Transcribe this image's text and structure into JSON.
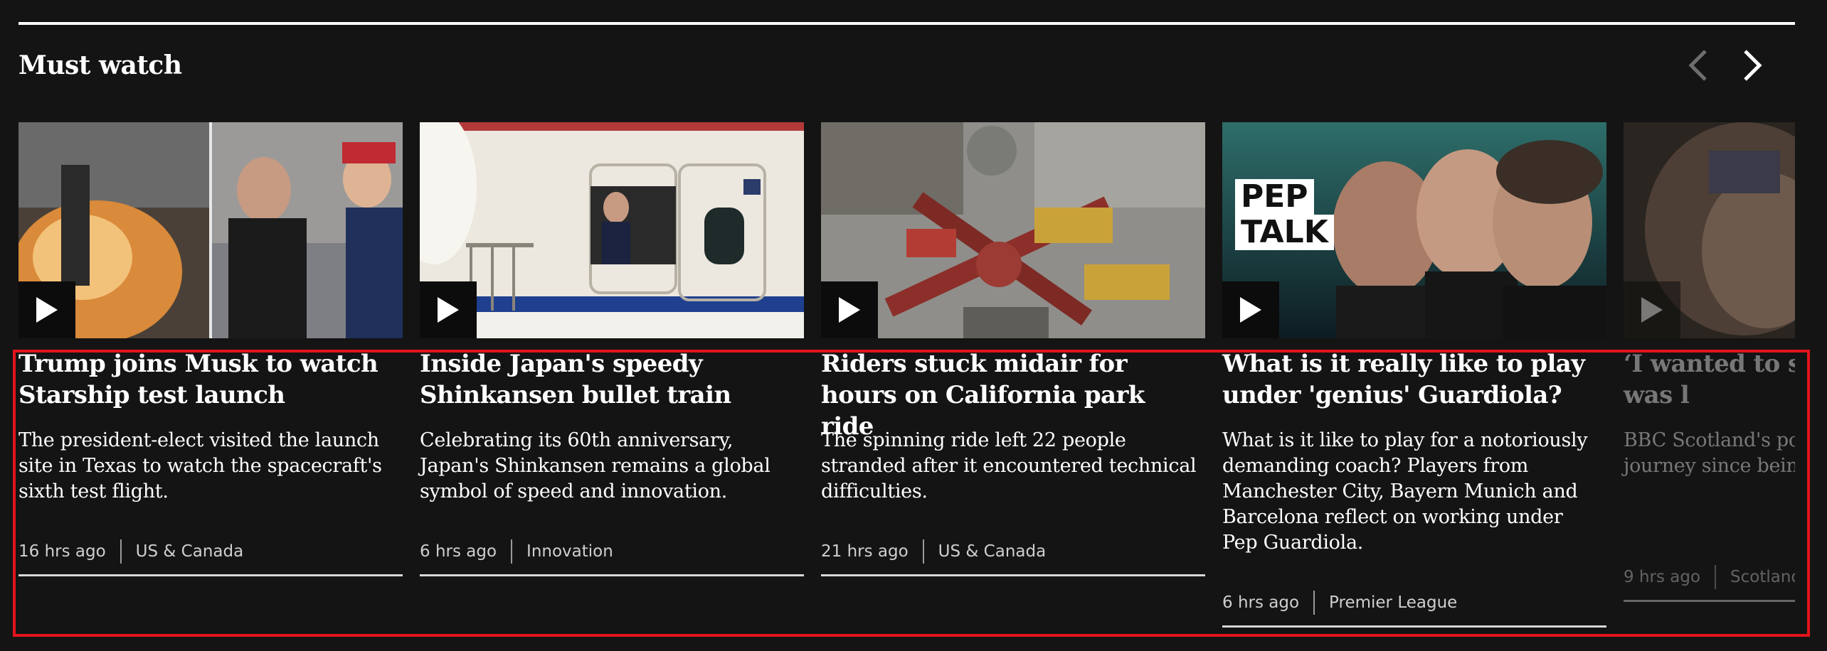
{
  "section": {
    "title": "Must watch",
    "prev_icon": "chevron-left-icon",
    "next_icon": "chevron-right-icon"
  },
  "cards": [
    {
      "headline": "Trump joins Musk to watch Starship test launch",
      "summary": "The president-elect visited the launch site in Texas to watch the spacecraft's sixth test flight.",
      "time": "16 hrs ago",
      "category": "US & Canada"
    },
    {
      "headline": "Inside Japan's speedy Shinkansen bullet train",
      "summary": "Celebrating its 60th anniversary, Japan's Shinkansen remains a global symbol of speed and innovation.",
      "time": "6 hrs ago",
      "category": "Innovation"
    },
    {
      "headline": "Riders stuck midair for hours on California park ride",
      "summary": "The spinning ride left 22 people stranded after it encountered technical difficulties.",
      "time": "21 hrs ago",
      "category": "US & Canada"
    },
    {
      "headline": "What is it really like to play under 'genius' Guardiola?",
      "summary": "What is it like to play for a notoriously demanding coach? Players from Manchester City, Bayern Munich and Barcelona reflect on working under Pep Guardiola.",
      "time": "6 hrs ago",
      "category": "Premier League",
      "thumb_text": [
        "PEP",
        "TALK"
      ]
    },
    {
      "headline": "‘I wanted to sh a seizure was l",
      "summary": "BBC Scotland's po Campbell has bee journey since bein cancerous brain tu",
      "time": "9 hrs ago",
      "category": "Scotland"
    }
  ],
  "colors": {
    "background": "#141414",
    "highlight": "#e3141c",
    "text": "#ffffff",
    "meta_text": "#cfcfcf"
  },
  "icons": {
    "play": "play-icon"
  }
}
